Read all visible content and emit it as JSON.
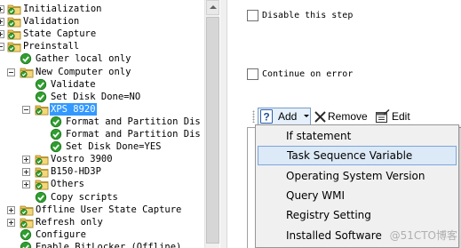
{
  "tree": {
    "nodes": [
      {
        "label": "Initialization",
        "icon": "folder-check-icon",
        "expander": "plus",
        "depth": 0
      },
      {
        "label": "Validation",
        "icon": "folder-check-icon",
        "expander": "plus",
        "depth": 0
      },
      {
        "label": "State Capture",
        "icon": "folder-check-icon",
        "expander": "plus",
        "depth": 0
      },
      {
        "label": "Preinstall",
        "icon": "folder-check-icon",
        "expander": "minus",
        "depth": 0
      },
      {
        "label": "Gather local only",
        "icon": "green-check-icon",
        "expander": "",
        "depth": 1
      },
      {
        "label": "New Computer only",
        "icon": "folder-check-icon",
        "expander": "minus",
        "depth": 1
      },
      {
        "label": "Validate",
        "icon": "green-check-icon",
        "expander": "",
        "depth": 2
      },
      {
        "label": "Set Disk Done=NO",
        "icon": "green-check-icon",
        "expander": "",
        "depth": 2
      },
      {
        "label": "XPS 8920",
        "icon": "folder-check-icon",
        "expander": "minus",
        "depth": 2,
        "selected": true
      },
      {
        "label": "Format and Partition Dis",
        "icon": "green-check-icon",
        "expander": "",
        "depth": 3
      },
      {
        "label": "Format and Partition Dis",
        "icon": "green-check-icon",
        "expander": "",
        "depth": 3
      },
      {
        "label": "Set Disk Done=YES",
        "icon": "green-check-icon",
        "expander": "",
        "depth": 3
      },
      {
        "label": "Vostro 3900",
        "icon": "folder-check-icon",
        "expander": "plus",
        "depth": 2
      },
      {
        "label": "B150-HD3P",
        "icon": "folder-check-icon",
        "expander": "plus",
        "depth": 2
      },
      {
        "label": "Others",
        "icon": "folder-check-icon",
        "expander": "plus",
        "depth": 2
      },
      {
        "label": "Copy scripts",
        "icon": "green-check-icon",
        "expander": "",
        "depth": 2
      },
      {
        "label": "Offline User State Capture",
        "icon": "folder-check-icon",
        "expander": "plus",
        "depth": 1
      },
      {
        "label": "Refresh only",
        "icon": "folder-check-icon",
        "expander": "plus",
        "depth": 1
      },
      {
        "label": "Configure",
        "icon": "green-check-icon",
        "expander": "",
        "depth": 1
      },
      {
        "label": "Enable BitLocker (Offline)",
        "icon": "green-check-icon",
        "expander": "",
        "depth": 1
      }
    ]
  },
  "options": {
    "disable_step_label": "Disable this step",
    "continue_on_error_label": "Continue on error"
  },
  "toolbar": {
    "add_label": "Add",
    "remove_label": "Remove",
    "edit_label": "Edit"
  },
  "add_menu": {
    "items": [
      "If statement",
      "Task Sequence Variable",
      "Operating System Version",
      "Query WMI",
      "Registry Setting",
      "Installed Software"
    ],
    "highlighted_index": 1
  },
  "watermark": "@51CTO博客",
  "colors": {
    "selection": "#3399ff",
    "check_green": "#2e9e2e",
    "folder_yellow": "#e8c35a",
    "menu_bg": "#f0f0f0",
    "menu_highlight": "#dce9f7"
  }
}
